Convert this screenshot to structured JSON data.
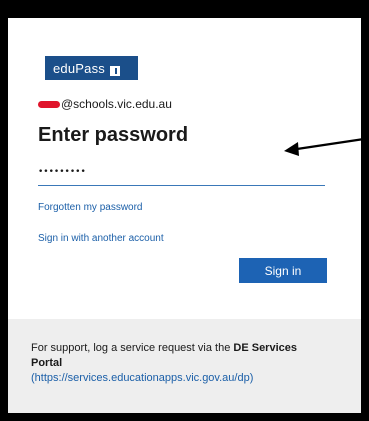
{
  "logo": {
    "text": "eduPass"
  },
  "account": {
    "email_visible": "@schools.vic.edu.au"
  },
  "heading": "Enter password",
  "password": {
    "masked_value": "•••••••••"
  },
  "links": {
    "forgot": "Forgotten my password",
    "other_account": "Sign in with another account"
  },
  "signin_button": "Sign in",
  "support": {
    "prefix": "For support, log a service request via the ",
    "portal_bold": "DE Services Portal",
    "url": "(https://services.educationapps.vic.gov.au/dp)"
  },
  "colors": {
    "brand": "#1b4f8a",
    "button": "#1d63b4",
    "link": "#1b5fa8",
    "redaction": "#e0142b"
  }
}
